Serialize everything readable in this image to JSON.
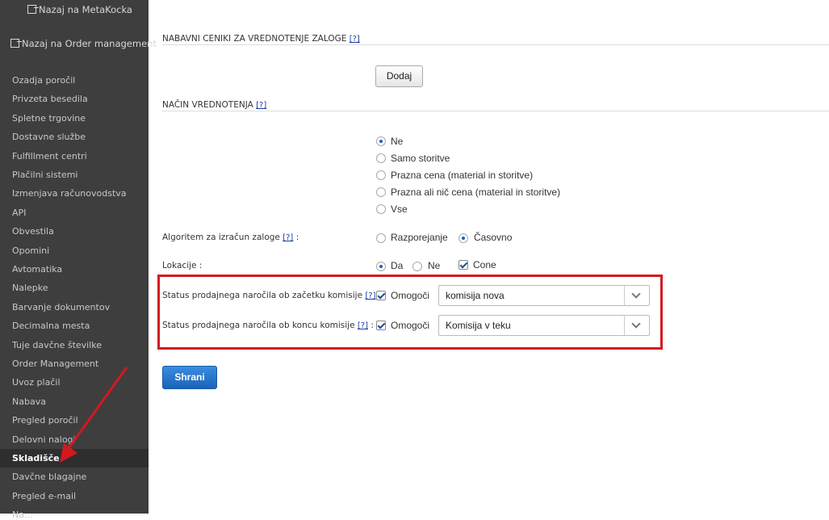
{
  "sidebar": {
    "top_links": [
      "Nazaj na MetaKocka",
      "Nazaj na Order management"
    ],
    "items": [
      "Ozadja poročil",
      "Privzeta besedila",
      "Spletne trgovine",
      "Dostavne službe",
      "Fulfillment centri",
      "Plačilni sistemi",
      "Izmenjava računovodstva",
      "API",
      "Obvestila",
      "Opomini",
      "Avtomatika",
      "Nalepke",
      "Barvanje dokumentov",
      "Decimalna mesta",
      "Tuje davčne številke",
      "Order Management",
      "Uvoz plačil",
      "Nabava",
      "Pregled poročil",
      "Delovni nalogi",
      "Skladišče",
      "Davčne blagajne",
      "Pregled e-mail",
      "Na..."
    ],
    "active": "Skladišče"
  },
  "section1": {
    "title": "NABAVNI CENIKI ZA VREDNOTENJE ZALOGE",
    "help": "[?]",
    "add_button": "Dodaj"
  },
  "section2": {
    "title": "NAČIN VREDNOTENJA",
    "help": "[?]",
    "options": [
      "Ne",
      "Samo storitve",
      "Prazna cena (material in storitve)",
      "Prazna ali nič cena (material in storitve)",
      "Vse"
    ],
    "selected": "Ne"
  },
  "algorithm": {
    "label": "Algoritem za izračun zaloge",
    "help": "[?]",
    "suffix": ":",
    "options": [
      "Razporejanje",
      "Časovno"
    ],
    "selected": "Časovno"
  },
  "locations": {
    "label": "Lokacije :",
    "options": [
      "Da",
      "Ne"
    ],
    "selected": "Da",
    "check_label": "Cone",
    "checked": true
  },
  "status_start": {
    "label": "Status prodajnega naročila ob začetku komisije",
    "help": "[?]",
    "suffix": ":",
    "check_label": "Omogoči",
    "checked": true,
    "value": "komisija nova"
  },
  "status_end": {
    "label": "Status prodajnega naročila ob koncu komisije",
    "help": "[?]",
    "suffix": ":",
    "check_label": "Omogoči",
    "checked": true,
    "value": "Komisija v teku"
  },
  "save_button": "Shrani",
  "colors": {
    "sidebar_bg": "#3e3e3e",
    "highlight": "#d4181f",
    "primary": "#1a63b8"
  }
}
